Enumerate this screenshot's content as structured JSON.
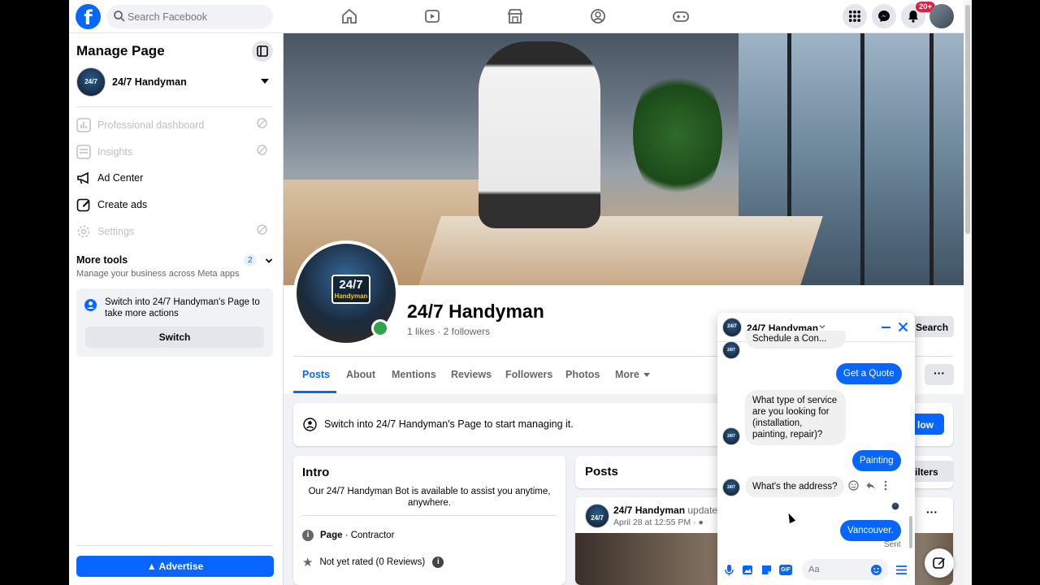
{
  "topbar": {
    "search_placeholder": "Search Facebook",
    "notification_count": "20+"
  },
  "sidebar": {
    "title": "Manage Page",
    "page_name": "24/7 Handyman",
    "items": [
      {
        "label": "Professional dashboard"
      },
      {
        "label": "Insights"
      },
      {
        "label": "Ad Center"
      },
      {
        "label": "Create ads"
      },
      {
        "label": "Settings"
      }
    ],
    "more_tools": {
      "title": "More tools",
      "subtitle": "Manage your business across Meta apps",
      "count": "2"
    },
    "switch_card": {
      "text": "Switch into 24/7 Handyman's Page to take more actions",
      "button": "Switch"
    },
    "advertise": "Advertise"
  },
  "profile": {
    "logo_number": "24/7",
    "logo_sub": "Handyman",
    "name": "24/7 Handyman",
    "stats": "1 likes · 2 followers",
    "search_label": "Search",
    "more_dots": "···"
  },
  "tabs": [
    "Posts",
    "About",
    "Mentions",
    "Reviews",
    "Followers",
    "Photos",
    "More"
  ],
  "switch_banner": {
    "text": "Switch into 24/7 Handyman's Page to start managing it.",
    "button_partial": "low"
  },
  "intro": {
    "title": "Intro",
    "bio": "Our 24/7 Handyman Bot is available to assist you anytime, anywhere.",
    "category_label": "Page",
    "category_value": " · Contractor",
    "rating": "Not yet rated (0 Reviews)"
  },
  "posts": {
    "title": "Posts",
    "filters_partial": "ilters",
    "post_author": "24/7 Handyman",
    "post_action": " updated",
    "post_date": "April 28 at 12:55 PM",
    "post_dots": "···"
  },
  "chat": {
    "title": "24/7 Handyman",
    "messages": [
      {
        "from": "page",
        "text": "Schedule a Con..."
      },
      {
        "from": "user",
        "text": "Get a Quote"
      },
      {
        "from": "page",
        "text": "What type of service are you looking for (installation, painting, repair)?"
      },
      {
        "from": "user",
        "text": "Painting"
      },
      {
        "from": "page",
        "text": "What's the address?"
      },
      {
        "from": "user",
        "text": "Vancouver."
      }
    ],
    "sent_label": "Sent",
    "input_placeholder": "Aa"
  }
}
